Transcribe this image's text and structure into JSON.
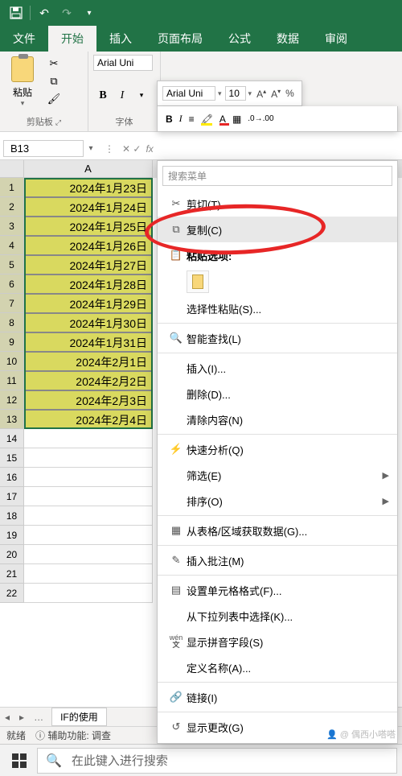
{
  "title_bar": {
    "save_icon": "save",
    "undo": "↶",
    "redo": "↷"
  },
  "ribbon_tabs": [
    "文件",
    "开始",
    "插入",
    "页面布局",
    "公式",
    "数据",
    "审阅"
  ],
  "active_tab_index": 1,
  "ribbon": {
    "clipboard_group": "剪贴板",
    "paste_label": "粘贴",
    "font_group": "字体",
    "font_name_1": "Arial Uni",
    "font_name_2": "Arial Uni",
    "font_size": "10"
  },
  "floating_toolbar": {
    "font": "Arial Uni",
    "size": "10",
    "pct": "%"
  },
  "name_box": "B13",
  "column_headers": [
    "A"
  ],
  "data_rows": [
    "2024年1月23日",
    "2024年1月24日",
    "2024年1月25日",
    "2024年1月26日",
    "2024年1月27日",
    "2024年1月28日",
    "2024年1月29日",
    "2024年1月30日",
    "2024年1月31日",
    "2024年2月1日",
    "2024年2月2日",
    "2024年2月3日",
    "2024年2月4日"
  ],
  "empty_row_count": 9,
  "context_menu": {
    "search_placeholder": "搜索菜单",
    "items": [
      {
        "icon": "cut",
        "label": "剪切(T)"
      },
      {
        "icon": "copy",
        "label": "复制(C)",
        "highlighted": true
      },
      {
        "icon": "paste",
        "label": "粘贴选项:",
        "header": true
      },
      {
        "paste_options": true
      },
      {
        "label": "选择性粘贴(S)..."
      },
      {
        "sep": true
      },
      {
        "icon": "lookup",
        "label": "智能查找(L)"
      },
      {
        "sep": true
      },
      {
        "label": "插入(I)..."
      },
      {
        "label": "删除(D)..."
      },
      {
        "label": "清除内容(N)"
      },
      {
        "sep": true
      },
      {
        "icon": "quick",
        "label": "快速分析(Q)"
      },
      {
        "label": "筛选(E)",
        "arrow": true
      },
      {
        "label": "排序(O)",
        "arrow": true
      },
      {
        "sep": true
      },
      {
        "icon": "table",
        "label": "从表格/区域获取数据(G)..."
      },
      {
        "sep": true
      },
      {
        "icon": "comment",
        "label": "插入批注(M)"
      },
      {
        "sep": true
      },
      {
        "icon": "format",
        "label": "设置单元格格式(F)..."
      },
      {
        "label": "从下拉列表中选择(K)..."
      },
      {
        "icon": "pinyin",
        "label": "显示拼音字段(S)"
      },
      {
        "label": "定义名称(A)..."
      },
      {
        "sep": true
      },
      {
        "icon": "link",
        "label": "链接(I)"
      },
      {
        "sep": true
      },
      {
        "icon": "changes",
        "label": "显示更改(G)"
      }
    ]
  },
  "sheet_tab": "IF的使用",
  "status_bar": {
    "ready": "就绪",
    "accessibility": "辅助功能: 调查"
  },
  "taskbar": {
    "search_placeholder": "在此键入进行搜索"
  },
  "watermark": "偶西小嗒嗒"
}
